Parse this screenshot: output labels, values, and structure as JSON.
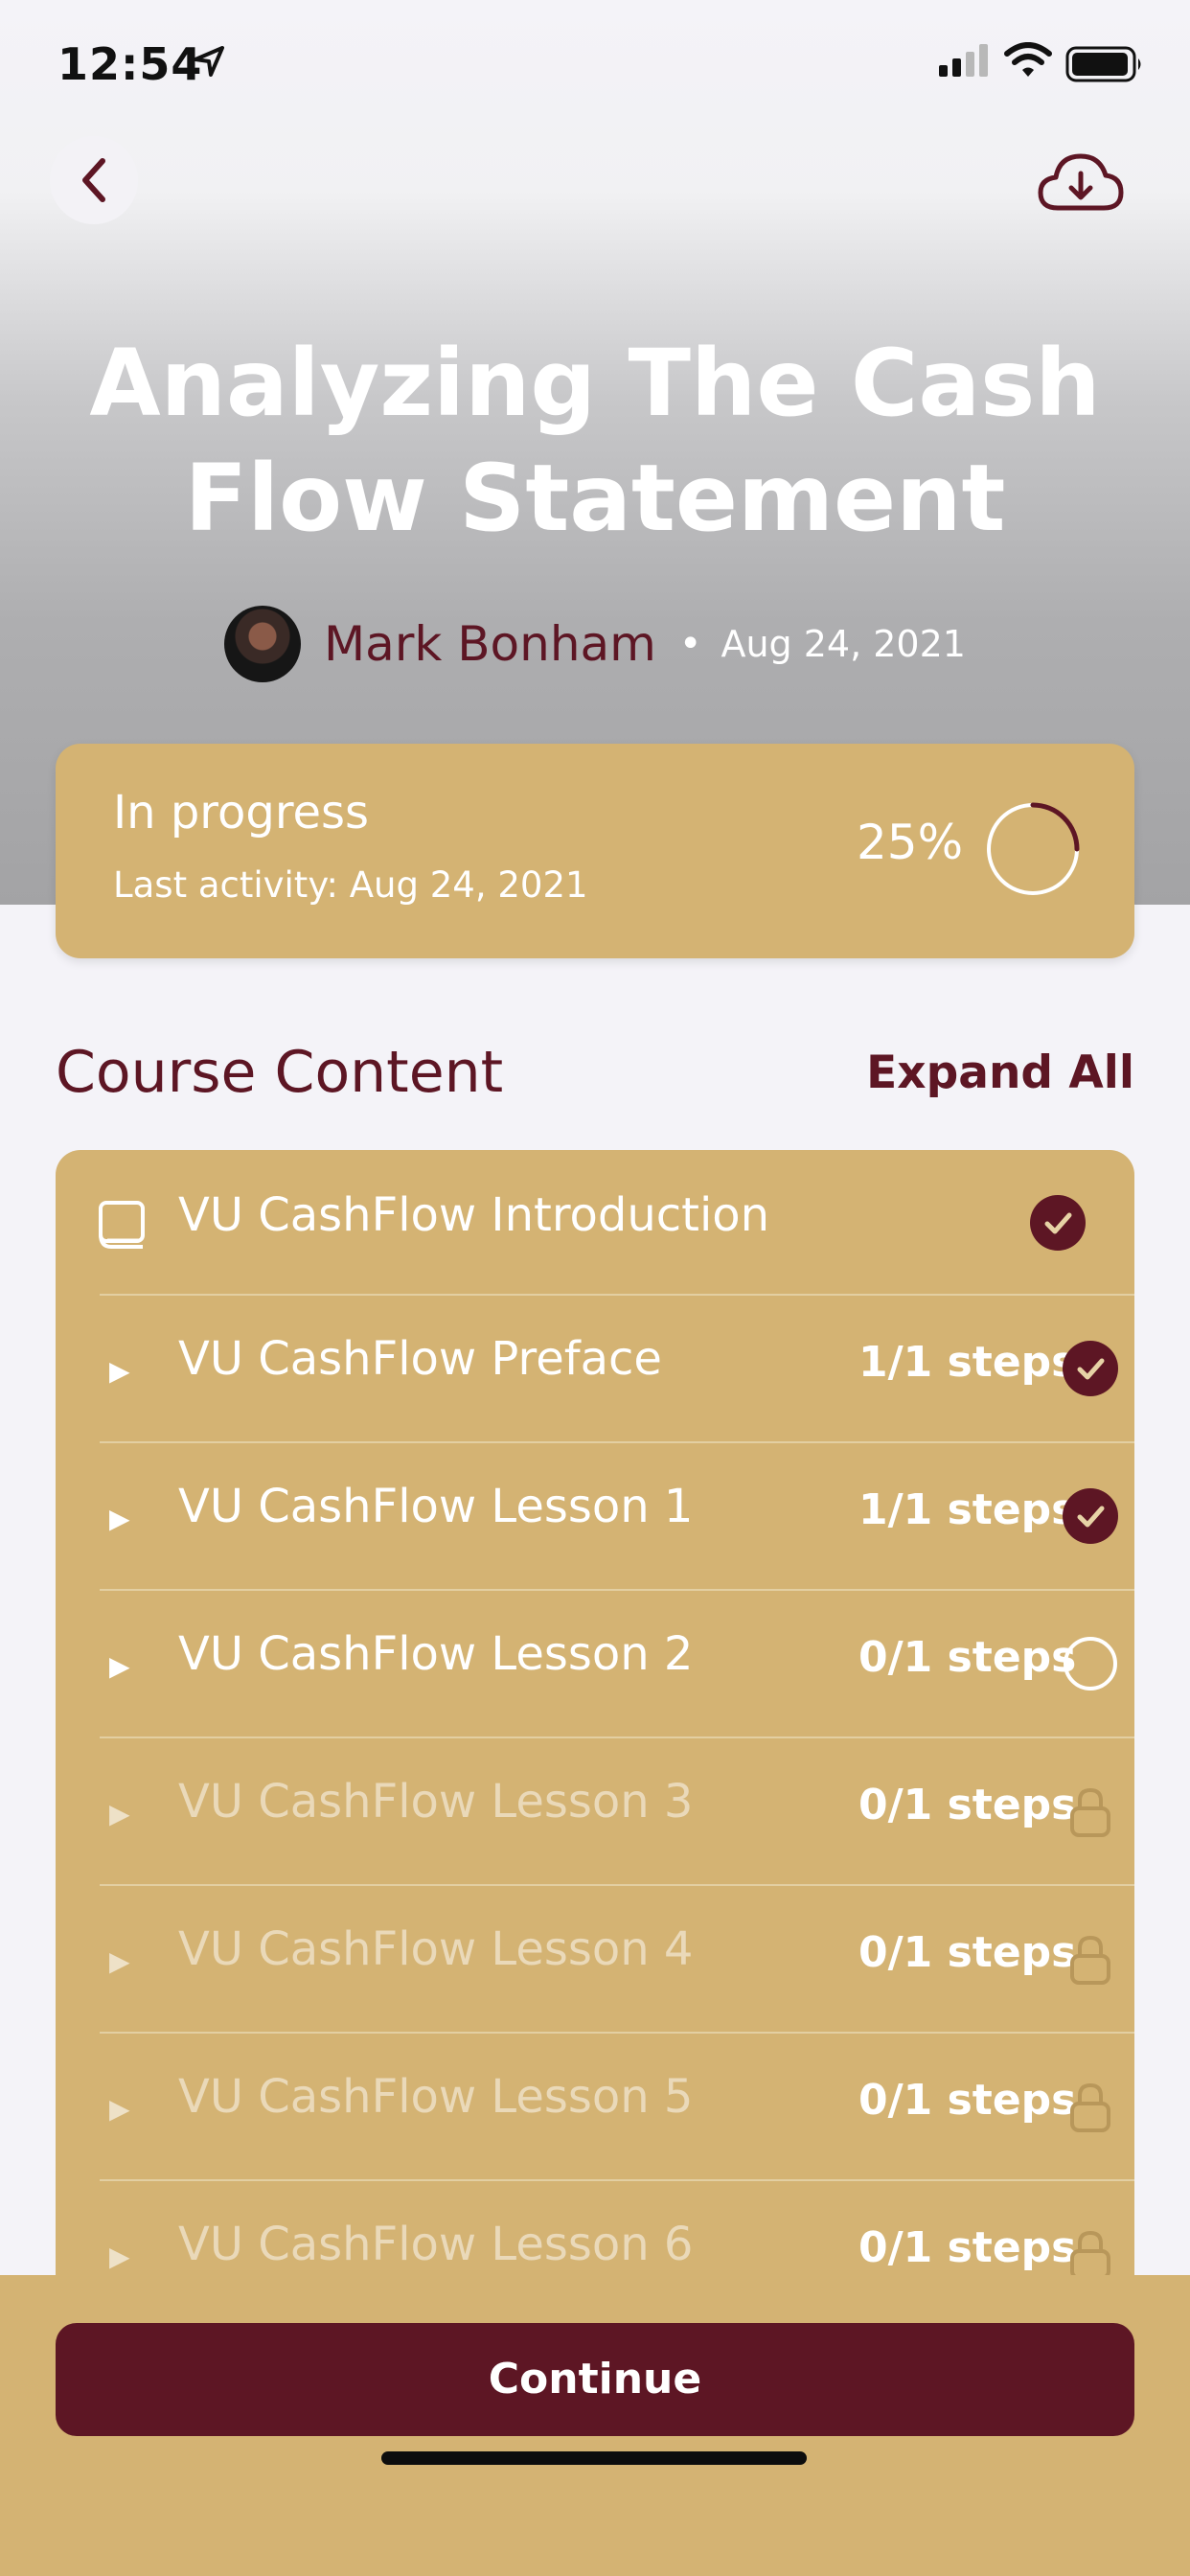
{
  "status_bar": {
    "time": "12:54",
    "icons": [
      "location-arrow-icon",
      "cellular-signal-icon",
      "wifi-icon",
      "battery-icon"
    ]
  },
  "nav": {
    "back_icon": "chevron-left-icon",
    "download_icon": "cloud-download-icon"
  },
  "course": {
    "title": "Analyzing The Cash Flow Statement",
    "author": "Mark Bonham",
    "separator": "•",
    "date": "Aug 24, 2021"
  },
  "progress": {
    "status": "In progress",
    "last_activity": "Last activity:  Aug 24, 2021",
    "percent_label": "25%",
    "percent_value": 25
  },
  "content": {
    "section_title": "Course Content",
    "expand_all": "Expand All",
    "topic": {
      "label": "VU CashFlow Introduction",
      "icon": "book-icon",
      "status": "complete"
    },
    "lessons": [
      {
        "label": "VU CashFlow Preface",
        "steps": "1/1 steps",
        "status": "complete"
      },
      {
        "label": "VU CashFlow Lesson 1",
        "steps": "1/1 steps",
        "status": "complete"
      },
      {
        "label": "VU CashFlow Lesson 2",
        "steps": "0/1 steps",
        "status": "incomplete"
      },
      {
        "label": "VU CashFlow Lesson 3",
        "steps": "0/1 steps",
        "status": "locked"
      },
      {
        "label": "VU CashFlow Lesson 4",
        "steps": "0/1 steps",
        "status": "locked"
      },
      {
        "label": "VU CashFlow Lesson 5",
        "steps": "0/1 steps",
        "status": "locked"
      },
      {
        "label": "VU CashFlow Lesson 6",
        "steps": "0/1 steps",
        "status": "locked"
      }
    ]
  },
  "footer": {
    "continue_label": "Continue"
  },
  "colors": {
    "maroon": "#5d1624",
    "gold": "#d4b373"
  }
}
